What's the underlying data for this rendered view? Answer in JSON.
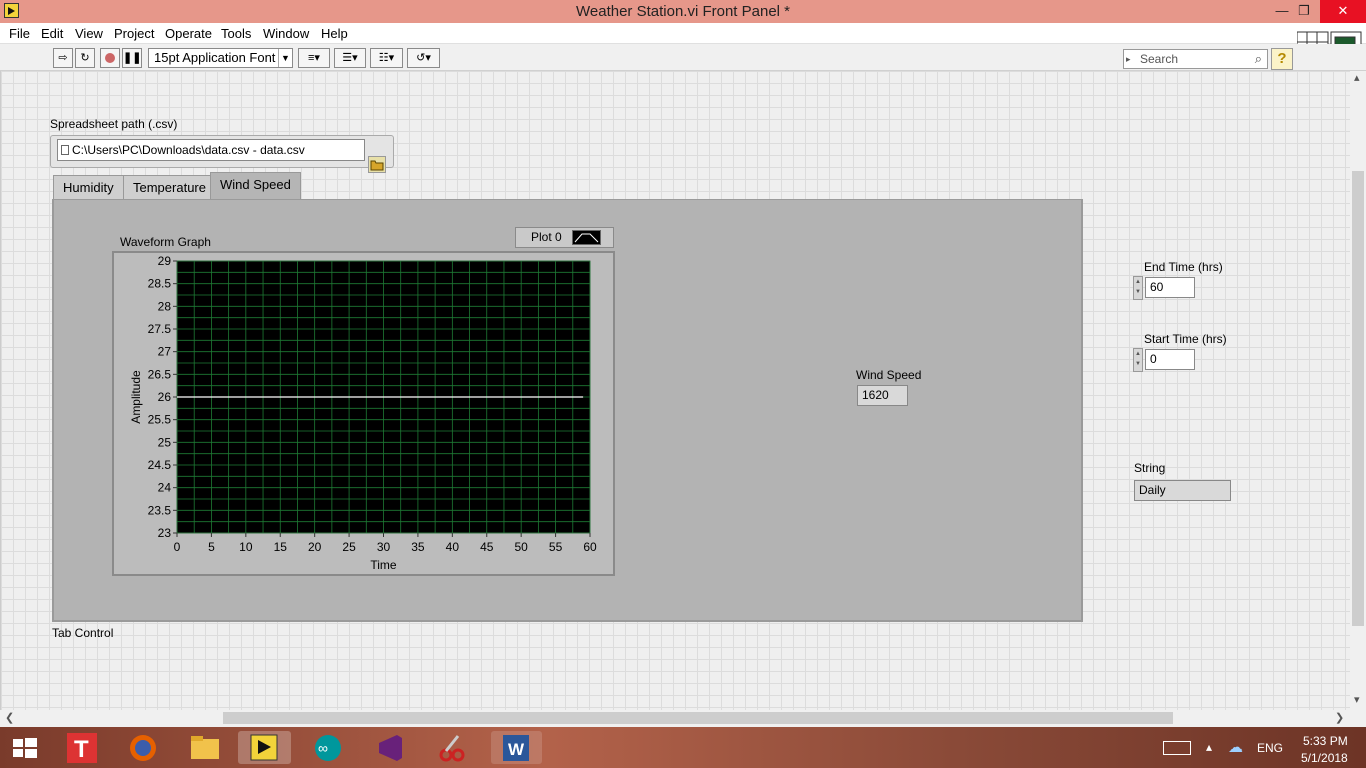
{
  "window": {
    "title": "Weather Station.vi Front Panel *",
    "controls": [
      "minimize-icon",
      "restore-icon",
      "close-icon"
    ]
  },
  "menu": [
    "File",
    "Edit",
    "View",
    "Project",
    "Operate",
    "Tools",
    "Window",
    "Help"
  ],
  "toolbar": {
    "font": "15pt Application Font",
    "search_placeholder": "Search",
    "help": "?"
  },
  "path_control": {
    "label": "Spreadsheet path (.csv)",
    "value": "C:\\Users\\PC\\Downloads\\data.csv - data.csv"
  },
  "tabs": {
    "items": [
      "Humidity",
      "Temperature",
      "Wind Speed"
    ],
    "active": "Wind Speed",
    "label": "Tab Control"
  },
  "graph": {
    "label": "Waveform Graph",
    "legend": "Plot 0"
  },
  "chart_data": {
    "type": "line",
    "title": "Waveform Graph",
    "xlabel": "Time",
    "ylabel": "Amplitude",
    "xlim": [
      0,
      60
    ],
    "ylim": [
      23,
      29
    ],
    "x_ticks": [
      "0",
      "5",
      "10",
      "15",
      "20",
      "25",
      "30",
      "35",
      "40",
      "45",
      "50",
      "55",
      "60"
    ],
    "y_ticks": [
      "29",
      "28.5",
      "28",
      "27.5",
      "27",
      "26.5",
      "26",
      "25.5",
      "25",
      "24.5",
      "24",
      "23.5",
      "23"
    ],
    "grid": true,
    "series": [
      {
        "name": "Plot 0",
        "x": [
          0,
          59
        ],
        "y": [
          26,
          26
        ],
        "color": "#ffffff"
      }
    ],
    "background": "#000000",
    "grid_color": "#1e7a34"
  },
  "wind_speed": {
    "label": "Wind Speed",
    "value": "1620"
  },
  "end_time": {
    "label": "End Time (hrs)",
    "value": "60"
  },
  "start_time": {
    "label": "Start Time (hrs)",
    "value": "0"
  },
  "string_ind": {
    "label": "String",
    "value": "Daily"
  },
  "taskbar": {
    "lang": "ENG",
    "time": "5:33 PM",
    "date": "5/1/2018"
  }
}
